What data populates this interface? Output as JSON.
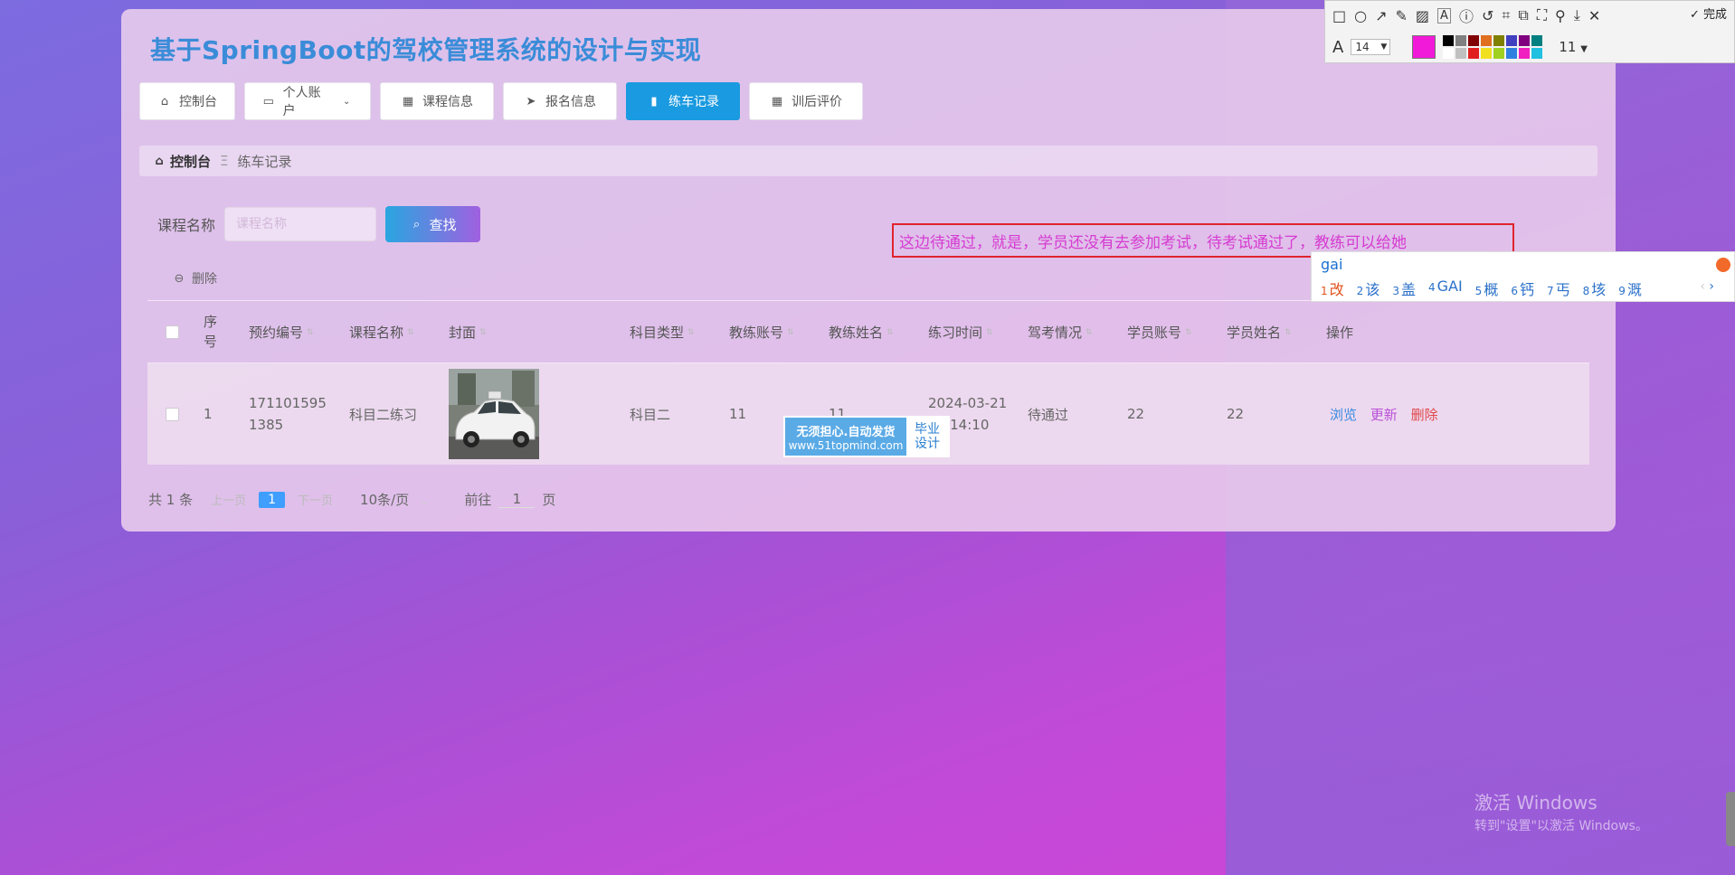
{
  "app": {
    "title": "基于SpringBoot的驾校管理系统的设计与实现"
  },
  "nav": [
    {
      "label": "控制台",
      "icon": "home-icon"
    },
    {
      "label": "个人账户",
      "icon": "wallet-icon",
      "has_dropdown": true
    },
    {
      "label": "课程信息",
      "icon": "grid-icon"
    },
    {
      "label": "报名信息",
      "icon": "send-icon"
    },
    {
      "label": "练车记录",
      "icon": "bar-chart-icon",
      "active": true
    },
    {
      "label": "训后评价",
      "icon": "grid-icon"
    }
  ],
  "breadcrumb": {
    "home": "控制台",
    "separator": "Ξ",
    "current": "练车记录"
  },
  "search": {
    "label": "课程名称",
    "placeholder": "课程名称",
    "button": "查找"
  },
  "actions": {
    "delete": "删除"
  },
  "table": {
    "headers": [
      "序号",
      "预约编号",
      "课程名称",
      "封面",
      "科目类型",
      "教练账号",
      "教练姓名",
      "练习时间",
      "驾考情况",
      "学员账号",
      "学员姓名",
      "操作"
    ],
    "rows": [
      {
        "index": "1",
        "booking_no": "1711015951385",
        "course": "科目二练习",
        "subject": "科目二",
        "coach_account": "11",
        "coach_name": "11",
        "time": "2024-03-21 14:14:10",
        "status": "待通过",
        "student_account": "22",
        "student_name": "22",
        "ops": [
          "浏览",
          "更新",
          "删除"
        ]
      }
    ]
  },
  "pagination": {
    "total": "共 1 条",
    "prev": "上一页",
    "current": "1",
    "next": "下一页",
    "page_size": "10条/页",
    "goto_prefix": "前往",
    "goto_value": "1",
    "goto_suffix": "页"
  },
  "annotation": {
    "text": "这边待通过，就是，学员还没有去参加考试，待考试通过了，教练可以给她"
  },
  "ime": {
    "input": "gai",
    "candidates": [
      {
        "n": "1",
        "w": "改"
      },
      {
        "n": "2",
        "w": "该"
      },
      {
        "n": "3",
        "w": "盖"
      },
      {
        "n": "4",
        "w": "GAI"
      },
      {
        "n": "5",
        "w": "概"
      },
      {
        "n": "6",
        "w": "钙"
      },
      {
        "n": "7",
        "w": "丐"
      },
      {
        "n": "8",
        "w": "垓"
      },
      {
        "n": "9",
        "w": "溉"
      }
    ]
  },
  "toolbar": {
    "done": "完成",
    "font_size": "14",
    "width_value": "11",
    "icons": [
      "rect-icon",
      "circle-icon",
      "arrow-icon",
      "pen-icon",
      "mosaic-icon",
      "text-icon",
      "number-icon",
      "undo-icon",
      "crop-icon",
      "copy-icon",
      "fullscreen-icon",
      "pin-icon",
      "save-icon",
      "close-icon"
    ],
    "current_color": "#f01ad8",
    "palette": [
      "#000000",
      "#808080",
      "#800000",
      "#e07020",
      "#808000",
      "#4040c0",
      "#800080",
      "#008080",
      "#ffffff",
      "#c0c0c0",
      "#e02020",
      "#f0e020",
      "#a0d020",
      "#3080e0",
      "#f020c0",
      "#20c0e0"
    ]
  },
  "watermark": {
    "line1": "无须担心.自动发货",
    "line2": "www.51topmind.com",
    "right1": "毕业",
    "right2": "设计"
  },
  "os": {
    "activate_title": "激活 Windows",
    "activate_sub": "转到\"设置\"以激活 Windows。"
  }
}
